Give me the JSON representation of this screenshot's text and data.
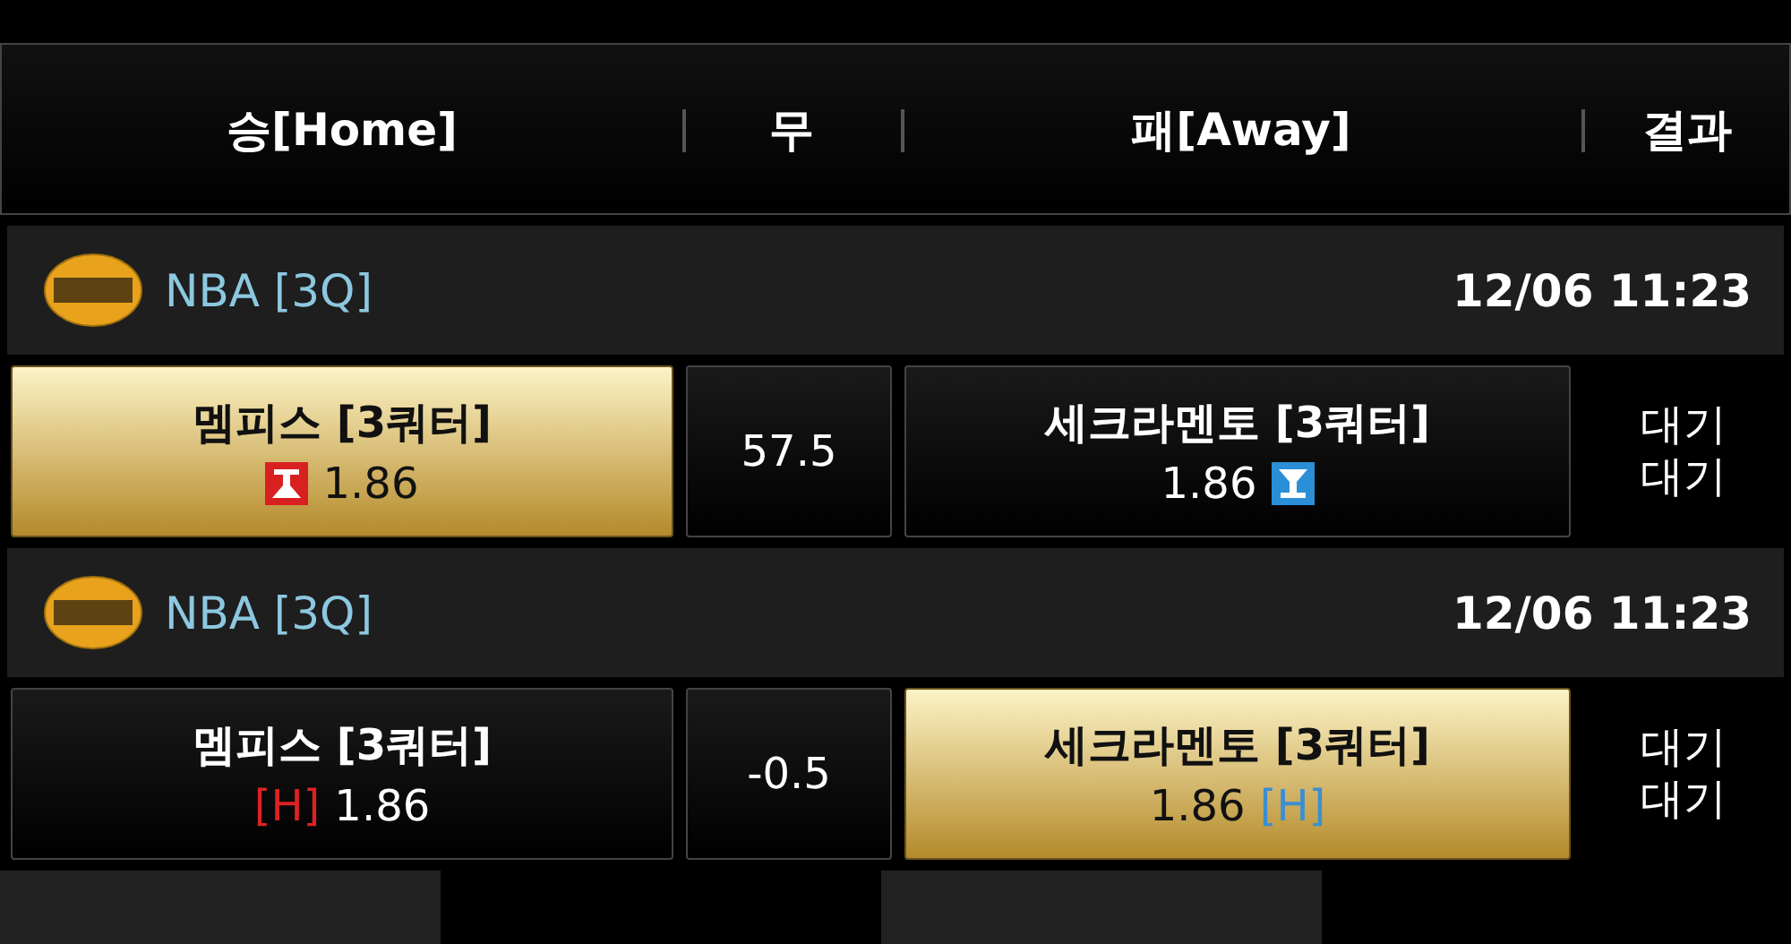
{
  "header": {
    "columns": [
      "승[Home]",
      "무",
      "패[Away]",
      "결과"
    ]
  },
  "games": [
    {
      "league": "NBA [3Q]",
      "time": "12/06 11:23",
      "home": {
        "name": "멤피스 [3쿼터]",
        "odds": "1.86",
        "selected": true,
        "marker": {
          "kind": "over"
        }
      },
      "draw": "57.5",
      "away": {
        "name": "세크라멘토 [3쿼터]",
        "odds": "1.86",
        "selected": false,
        "marker": {
          "kind": "under"
        }
      },
      "result": [
        "대기",
        "대기"
      ]
    },
    {
      "league": "NBA [3Q]",
      "time": "12/06 11:23",
      "home": {
        "name": "멤피스 [3쿼터]",
        "odds": "1.86",
        "selected": false,
        "marker": {
          "kind": "handicap",
          "text": "[H]"
        }
      },
      "draw": "-0.5",
      "away": {
        "name": "세크라멘토 [3쿼터]",
        "odds": "1.86",
        "selected": true,
        "marker": {
          "kind": "handicap",
          "text": "[H]"
        }
      },
      "result": [
        "대기",
        "대기"
      ]
    }
  ]
}
